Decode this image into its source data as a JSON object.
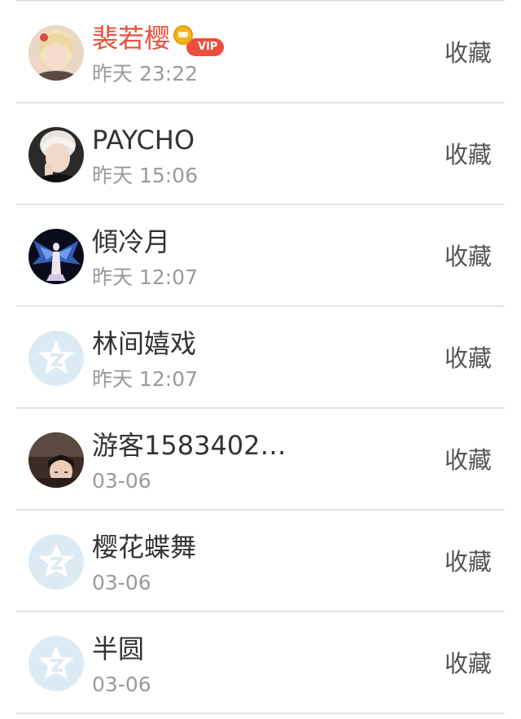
{
  "contacts": [
    {
      "name": "裴若樱",
      "highlight": true,
      "vip_label": "VIP",
      "time": "昨天 23:22",
      "action": "收藏",
      "avatar": "photo-girl-blonde"
    },
    {
      "name": "PAYCHO",
      "highlight": false,
      "time": "昨天 15:06",
      "action": "收藏",
      "avatar": "photo-boy-white-hair"
    },
    {
      "name": "傾冷月",
      "highlight": false,
      "time": "昨天 12:07",
      "action": "收藏",
      "avatar": "photo-angel-wings"
    },
    {
      "name": "林间嬉戏",
      "highlight": false,
      "time": "昨天 12:07",
      "action": "收藏",
      "avatar": "default-qzone-star"
    },
    {
      "name": "游客1583402…",
      "highlight": false,
      "time": "03-06",
      "action": "收藏",
      "avatar": "photo-girl-dark"
    },
    {
      "name": "樱花蝶舞",
      "highlight": false,
      "time": "03-06",
      "action": "收藏",
      "avatar": "default-qzone-star"
    },
    {
      "name": "半圆",
      "highlight": false,
      "time": "03-06",
      "action": "收藏",
      "avatar": "default-qzone-star"
    }
  ],
  "colors": {
    "vip_name": "#ec4f3a",
    "default_avatar_bg": "#dceaf3",
    "default_avatar_star": "#ffffff"
  }
}
